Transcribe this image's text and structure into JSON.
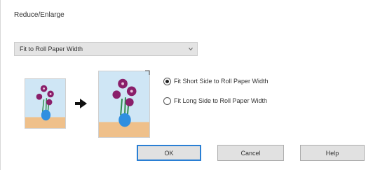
{
  "dialog": {
    "title": "Reduce/Enlarge"
  },
  "select": {
    "value": "Fit to Roll Paper Width",
    "chevron_icon": "chevron-down-icon"
  },
  "preview": {
    "arrow_icon": "arrow-right-icon",
    "sky_color": "#cfe6f5",
    "table_color": "#efc08a",
    "vase_color": "#2f8fe0",
    "flower_color": "#8a1f6a",
    "leaf_color": "#2c8a4a"
  },
  "options": [
    {
      "label": "Fit Short Side to Roll Paper Width",
      "selected": true
    },
    {
      "label": "Fit Long Side to Roll Paper Width",
      "selected": false
    }
  ],
  "buttons": {
    "ok": "OK",
    "cancel": "Cancel",
    "help": "Help"
  },
  "colors": {
    "focus_border": "#2a7fd4",
    "button_face": "#e1e1e1"
  }
}
